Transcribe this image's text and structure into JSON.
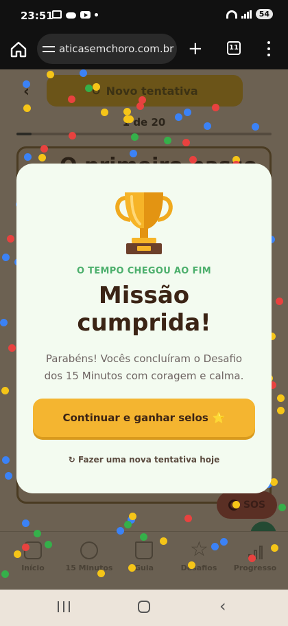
{
  "status_bar": {
    "time": "23:51",
    "battery": "54"
  },
  "browser": {
    "url": "aticasemchoro.com.br",
    "tab_count": "11",
    "new_tab_label": "+"
  },
  "background_page": {
    "back_glyph": "‹",
    "retry_button": {
      "icon": "↻",
      "label": "Novo tentativa"
    },
    "counter": "1 de 20",
    "progress_fraction": 0.06,
    "card_title": "O primeiro passo",
    "sos_label": "SOS",
    "nav": [
      {
        "label": "Início",
        "icon": "home-icon"
      },
      {
        "label": "15 Minutos",
        "icon": "clock-icon"
      },
      {
        "label": "Guia",
        "icon": "book-icon"
      },
      {
        "label": "Desafios",
        "icon": "star-icon"
      },
      {
        "label": "Progresso",
        "icon": "bar-chart-icon"
      }
    ]
  },
  "modal": {
    "kicker": "O TEMPO CHEGOU AO FIM",
    "title_line1": "Missão",
    "title_line2": "cumprida!",
    "body": "Parabéns! Vocês concluíram o Desafio dos 15 Minutos com coragem e calma.",
    "primary_button": {
      "label": "Continuar e ganhar selos",
      "icon": "⭐"
    },
    "secondary_link": {
      "icon": "↻",
      "label": "Fazer uma nova tentativa hoje"
    }
  },
  "colors": {
    "accent_yellow": "#f4b530",
    "kicker_green": "#4caf6c",
    "title_brown": "#3b2415",
    "modal_bg": "#f3fbf0",
    "confetti": [
      "#f5c518",
      "#e8423f",
      "#3b82f6",
      "#35b04a",
      "#f5c518"
    ]
  }
}
